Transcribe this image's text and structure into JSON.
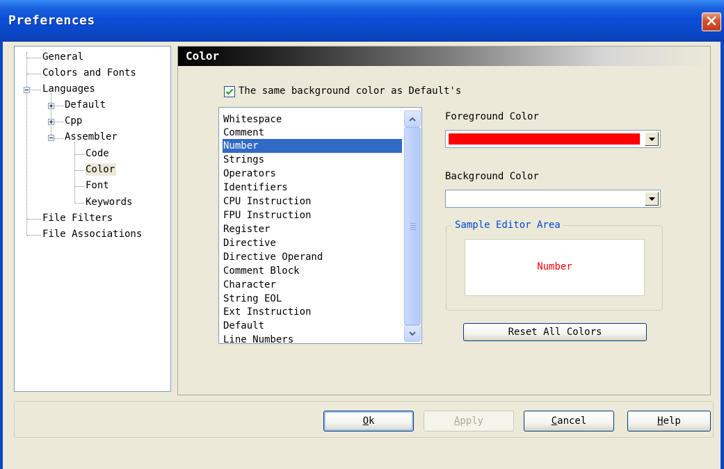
{
  "window": {
    "title": "Preferences"
  },
  "tree": {
    "items": [
      {
        "label": "General"
      },
      {
        "label": "Colors and Fonts"
      },
      {
        "label": "Languages"
      },
      {
        "label": "Default"
      },
      {
        "label": "Cpp"
      },
      {
        "label": "Assembler"
      },
      {
        "label": "Code"
      },
      {
        "label": "Color",
        "selected": true
      },
      {
        "label": "Font"
      },
      {
        "label": "Keywords"
      },
      {
        "label": "File Filters"
      },
      {
        "label": "File Associations"
      }
    ]
  },
  "panel": {
    "title": "Color",
    "same_bg_checkbox": {
      "label": "The same background color as Default's",
      "checked": true
    },
    "items": [
      "Whitespace",
      "Comment",
      "Number",
      "Strings",
      "Operators",
      "Identifiers",
      "CPU Instruction",
      "FPU Instruction",
      "Register",
      "Directive",
      "Directive Operand",
      "Comment Block",
      "Character",
      "String EOL",
      "Ext Instruction",
      "Default",
      "Line Numbers"
    ],
    "selected_item": "Number",
    "foreground": {
      "label": "Foreground Color",
      "color": "#ff0000"
    },
    "background": {
      "label": "Background Color",
      "color": "#ffffff"
    },
    "sample": {
      "title": "Sample Editor Area",
      "text": "Number",
      "text_color": "#ff0000"
    },
    "reset_button": "Reset All Colors"
  },
  "footer": {
    "ok": {
      "mnemonic": "O",
      "rest": "k"
    },
    "apply": {
      "mnemonic": "A",
      "rest": "pply",
      "disabled": true
    },
    "cancel": {
      "mnemonic": "C",
      "rest": "ancel"
    },
    "help": {
      "mnemonic": "H",
      "rest": "elp"
    }
  },
  "colors": {
    "titlebar": "#0a48c9",
    "selection": "#316ac5",
    "dialog_bg": "#ece9d8"
  }
}
